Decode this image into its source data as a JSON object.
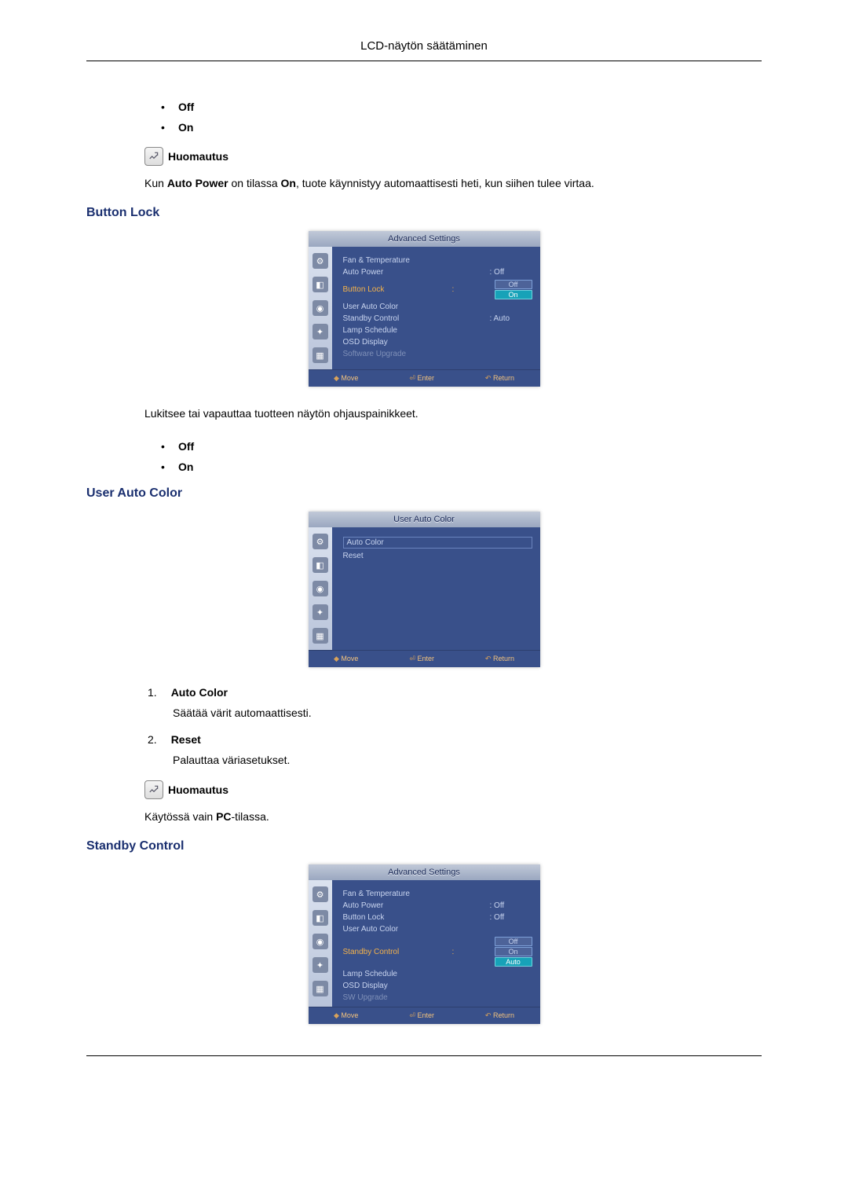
{
  "header": "LCD-näytön säätäminen",
  "top_options": [
    "Off",
    "On"
  ],
  "note_label": "Huomautus",
  "auto_power_note": {
    "pre": "Kun ",
    "b1": "Auto Power",
    "mid": " on tilassa ",
    "b2": "On",
    "post": ", tuote käynnistyy automaattisesti heti, kun siihen tulee virtaa."
  },
  "sections": {
    "button_lock": {
      "title": "Button Lock",
      "desc": "Lukitsee tai vapauttaa tuotteen näytön ohjauspainikkeet.",
      "options": [
        "Off",
        "On"
      ]
    },
    "user_auto_color": {
      "title": "User Auto Color",
      "items": [
        {
          "label": "Auto Color",
          "desc": "Säätää värit automaattisesti."
        },
        {
          "label": "Reset",
          "desc": "Palauttaa väriasetukset."
        }
      ],
      "note_pre": "Käytössä vain ",
      "note_b": "PC",
      "note_post": "-tilassa."
    },
    "standby_control": {
      "title": "Standby Control"
    }
  },
  "osd": {
    "adv_title": "Advanced Settings",
    "uac_title": "User Auto Color",
    "foot_move": "Move",
    "foot_enter": "Enter",
    "foot_return": "Return",
    "menu1": {
      "fan": "Fan & Temperature",
      "auto_power": "Auto Power",
      "auto_power_v": ": Off",
      "button_lock": "Button Lock",
      "button_lock_opts": [
        "Off",
        "On"
      ],
      "uac": "User Auto Color",
      "standby": "Standby Control",
      "standby_v": ": Auto",
      "lamp": "Lamp Schedule",
      "osd_disp": "OSD Display",
      "sw": "Software Upgrade"
    },
    "menu2": {
      "auto_color": "Auto Color",
      "reset": "Reset"
    },
    "menu3": {
      "fan": "Fan & Temperature",
      "auto_power": "Auto Power",
      "auto_power_v": ": Off",
      "button_lock": "Button Lock",
      "button_lock_v": ": Off",
      "uac": "User Auto Color",
      "standby": "Standby Control",
      "standby_opts": [
        "Off",
        "On",
        "Auto"
      ],
      "lamp": "Lamp Schedule",
      "osd_disp": "OSD Display",
      "sw": "SW Upgrade"
    }
  }
}
